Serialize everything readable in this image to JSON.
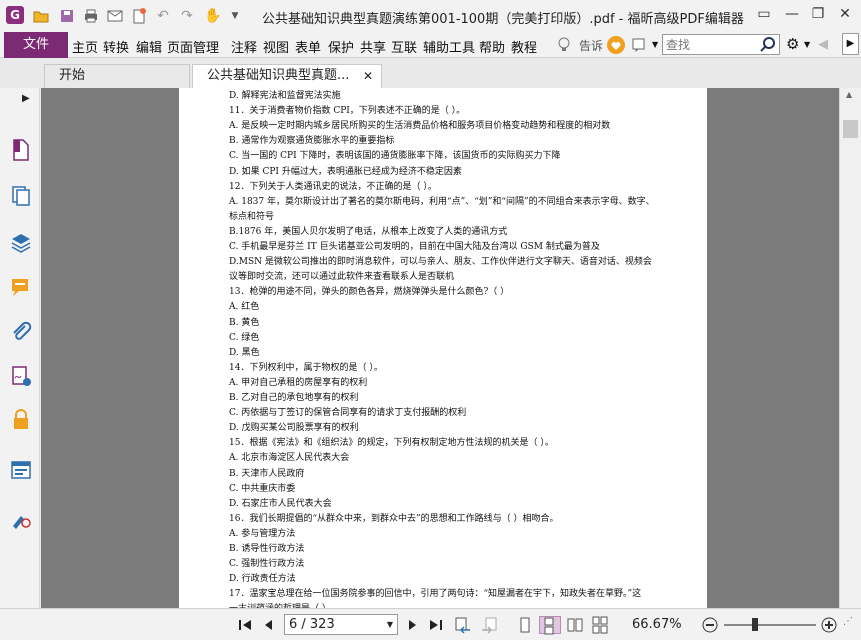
{
  "app": {
    "title": "公共基础知识典型真题演练第001-100期（完美打印版）.pdf - 福昕高级PDF编辑器",
    "logo_letter": "G",
    "accent": "#7c2a74"
  },
  "menu": {
    "file": "文件",
    "items": [
      "主页",
      "转换",
      "编辑",
      "页面管理",
      "注释",
      "视图",
      "表单",
      "保护",
      "共享",
      "互联",
      "辅助工具",
      "帮助",
      "教程"
    ],
    "tell_me": "告诉",
    "search_placeholder": "查找"
  },
  "tabs": [
    {
      "label": "开始"
    },
    {
      "label": "公共基础知识典型真题..."
    }
  ],
  "document": {
    "lines": [
      "D. 解释宪法和监督宪法实施",
      "11．关于消费者物价指数 CPI，下列表述不正确的是（ ）。",
      "A. 是反映一定时期内城乡居民所购买的生活消费品价格和服务项目价格变动趋势和程度的相对数",
      "B. 通常作为观察通货膨胀水平的重要指标",
      "C. 当一国的 CPI 下降时，表明该国的通货膨胀率下降，该国货币的实际购买力下降",
      "D. 如果 CPI 升幅过大，表明通胀已经成为经济不稳定因素",
      "12．下列关于人类通讯史的说法，不正确的是（ ）。",
      "A. 1837 年，莫尔斯设计出了著名的莫尔斯电码，利用“点”、“划”和“间隔”的不同组合来表示字母、数字、",
      "标点和符号",
      "B.1876 年，美国人贝尔发明了电话，从根本上改变了人类的通讯方式",
      "C. 手机最早是芬兰 IT 巨头诺基亚公司发明的，目前在中国大陆及台湾以 GSM 制式最为普及",
      "D.MSN 是微软公司推出的即时消息软件，可以与亲人、朋友、工作伙伴进行文字聊天、语音对话、视频会",
      "议等即时交流，还可以通过此软件来查看联系人是否联机",
      "13．枪弹的用途不同，弹头的颜色各异，燃烧弹弹头是什么颜色?（ ）",
      "A. 红色",
      "B. 黄色",
      "C. 绿色",
      "D. 黑色",
      "14．下列权利中，属于物权的是（ ）。",
      "A. 甲对自己承租的房屋享有的权利",
      "B. 乙对自己的承包地享有的权利",
      "C. 丙依据与丁签订的保管合同享有的请求丁支付报酬的权利",
      "D. 戊购买某公司股票享有的权利",
      "15．根据《宪法》和《组织法》的规定，下列有权制定地方性法规的机关是（ ）。",
      "A. 北京市海淀区人民代表大会",
      "B. 天津市人民政府",
      "C. 中共重庆市委",
      "D. 石家庄市人民代表大会",
      "16．我们长期提倡的“从群众中来，到群众中去”的思想和工作路线与（ ）相吻合。",
      "A. 参与管理方法",
      "B. 诱导性行政方法",
      "C. 强制性行政方法",
      "D. 行政责任方法",
      "17．温家宝总理在给一位国务院参事的回信中，引用了两句诗：“知屋漏者在宇下，知政失者在草野。”这",
      "一古训蕴涵的哲理是（ ）。"
    ]
  },
  "status": {
    "page_value": "6 / 323",
    "zoom": "66.67%"
  },
  "icons": {
    "quick_access": [
      "open-icon",
      "save-icon",
      "print-icon",
      "email-icon",
      "new-icon",
      "undo-icon",
      "redo-icon",
      "hand-tool-icon"
    ],
    "sidebar": [
      "pages-icon",
      "copy-icon",
      "layers-icon",
      "comments-icon",
      "attachments-icon",
      "signature-icon",
      "security-icon",
      "form-icon",
      "certificate-icon"
    ]
  }
}
